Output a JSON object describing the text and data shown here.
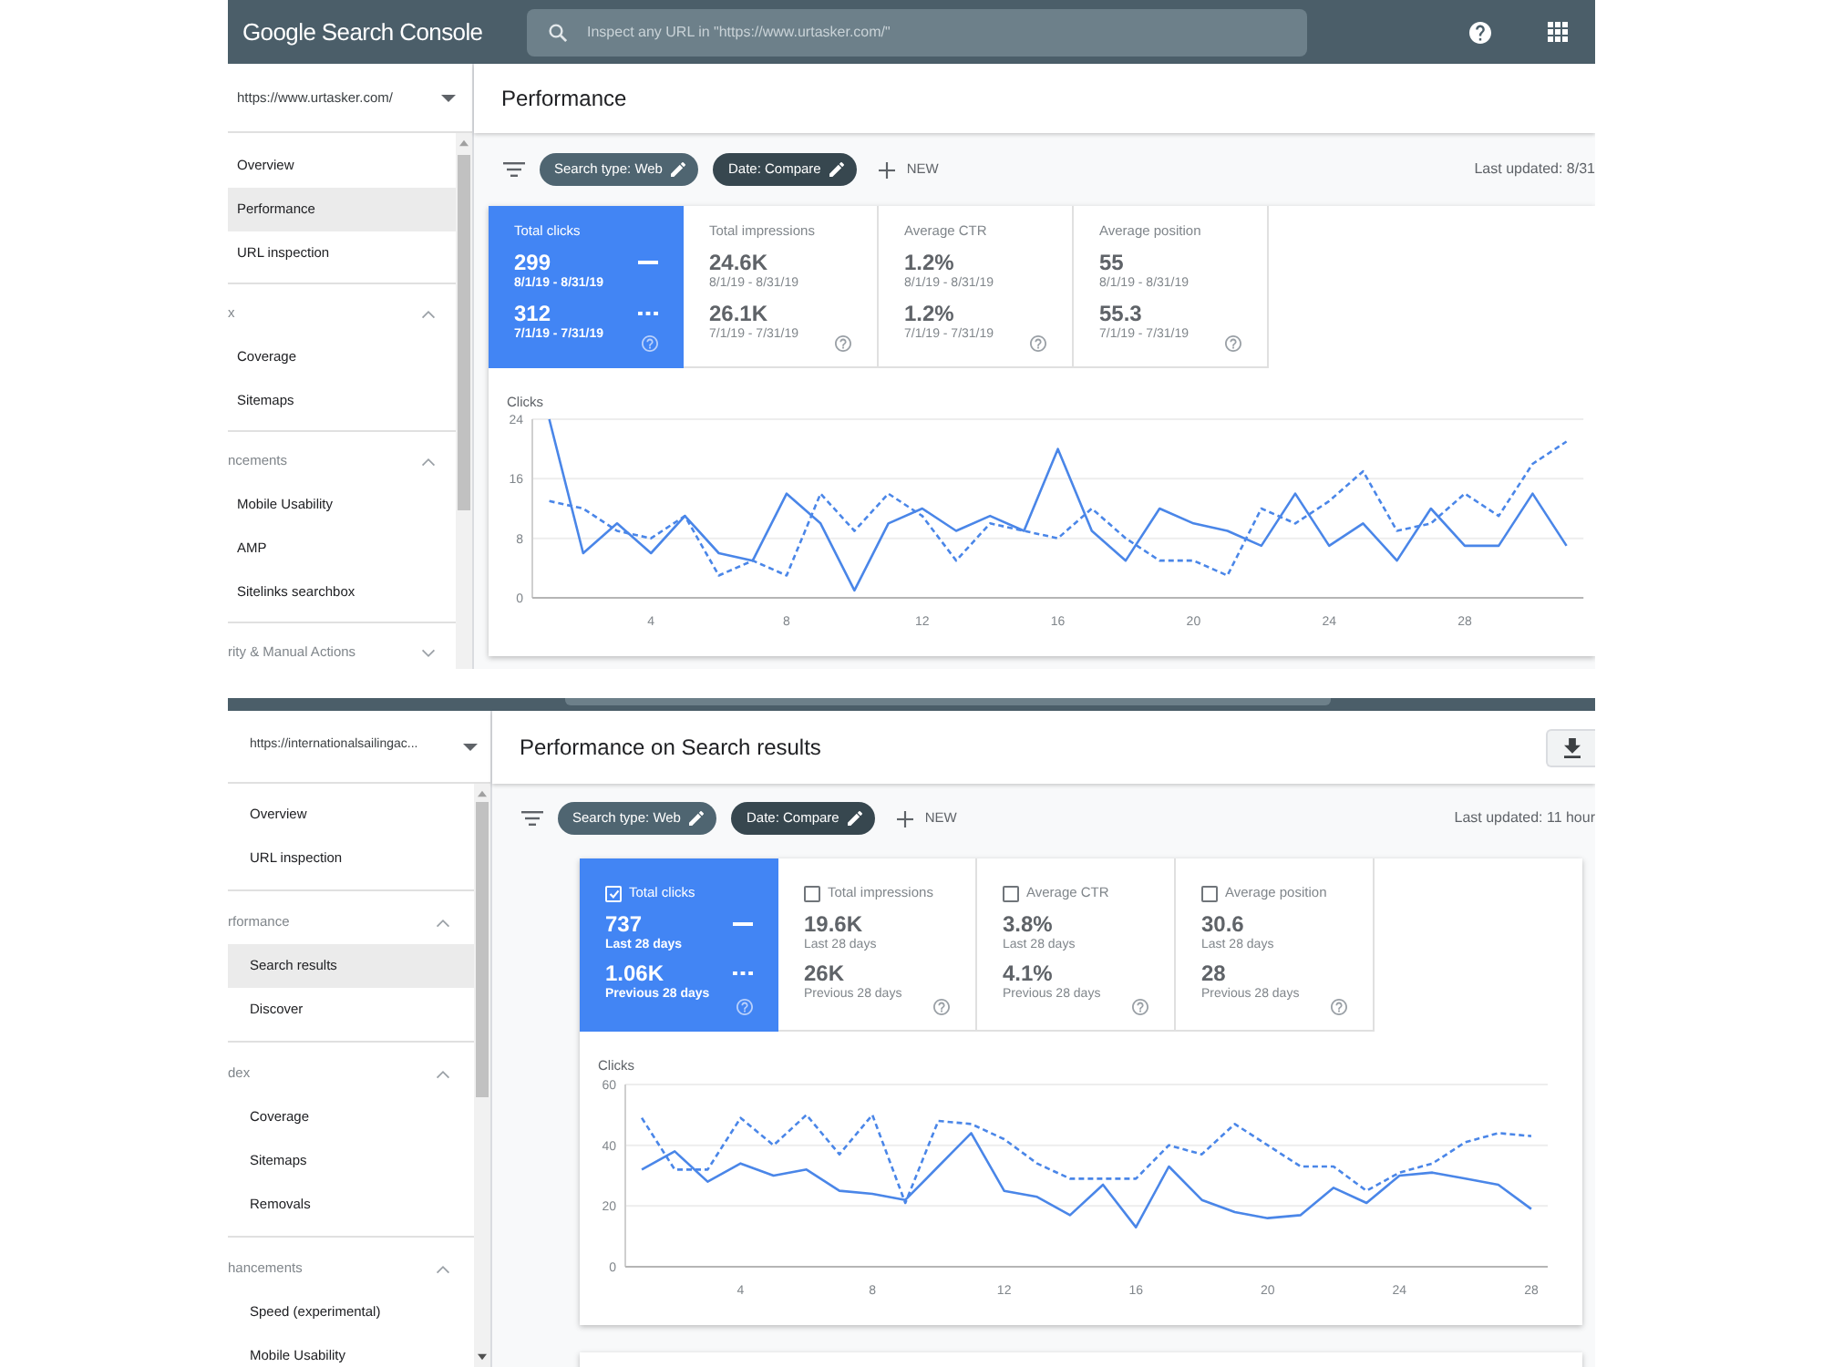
{
  "screens": [
    {
      "header": {
        "kind": "full",
        "logo": "Google Search Console",
        "search": {
          "placeholder": "Inspect any URL in \"https://www.urtasker.com/\""
        }
      },
      "sidebar": {
        "property": "https://www.urtasker.com/",
        "nav": [
          {
            "kind": "link",
            "label": "Overview",
            "selected": false
          },
          {
            "kind": "link",
            "label": "Performance",
            "selected": true
          },
          {
            "kind": "link",
            "label": "URL inspection",
            "selected": false
          },
          {
            "kind": "section",
            "label": "x",
            "expanded": true,
            "children": [
              {
                "label": "Coverage",
                "selected": false
              },
              {
                "label": "Sitemaps",
                "selected": false
              }
            ]
          },
          {
            "kind": "section",
            "label": "ncements",
            "expanded": true,
            "children": [
              {
                "label": "Mobile Usability",
                "selected": false
              },
              {
                "label": "AMP",
                "selected": false
              },
              {
                "label": "Sitelinks searchbox",
                "selected": false
              }
            ]
          },
          {
            "kind": "section",
            "label": "rity & Manual Actions",
            "expanded": false
          }
        ]
      },
      "page_title": "Performance",
      "filters": {
        "chips": [
          {
            "label": "Search type: Web",
            "color": "#4f6571"
          },
          {
            "label": "Date: Compare",
            "color": "#37474f"
          }
        ],
        "new_label": "NEW",
        "last_updated": "Last updated: 8/31"
      },
      "metrics": [
        {
          "label": "Total clicks",
          "selected": true,
          "rows": [
            {
              "value": "299",
              "period": "8/1/19 - 8/31/19"
            },
            {
              "value": "312",
              "period": "7/1/19 - 7/31/19"
            }
          ]
        },
        {
          "label": "Total impressions",
          "selected": false,
          "rows": [
            {
              "value": "24.6K",
              "period": "8/1/19 - 8/31/19"
            },
            {
              "value": "26.1K",
              "period": "7/1/19 - 7/31/19"
            }
          ]
        },
        {
          "label": "Average CTR",
          "selected": false,
          "rows": [
            {
              "value": "1.2%",
              "period": "8/1/19 - 8/31/19"
            },
            {
              "value": "1.2%",
              "period": "7/1/19 - 7/31/19"
            }
          ]
        },
        {
          "label": "Average position",
          "selected": false,
          "rows": [
            {
              "value": "55",
              "period": "8/1/19 - 8/31/19"
            },
            {
              "value": "55.3",
              "period": "7/1/19 - 7/31/19"
            }
          ]
        }
      ],
      "chart_data": {
        "type": "line",
        "ylabel": "Clicks",
        "x": [
          1,
          2,
          3,
          4,
          5,
          6,
          7,
          8,
          9,
          10,
          11,
          12,
          13,
          14,
          15,
          16,
          17,
          18,
          19,
          20,
          21,
          22,
          23,
          24,
          25,
          26,
          27,
          28,
          29,
          30,
          31
        ],
        "xlim": [
          0.5,
          31.5
        ],
        "ylim": [
          0,
          24
        ],
        "xticks": [
          4,
          8,
          12,
          16,
          20,
          24,
          28
        ],
        "yticks": [
          0,
          8,
          16,
          24
        ],
        "series": [
          {
            "color": "#4a86e8",
            "line_style": "solid",
            "values": [
              24,
              6,
              10,
              6,
              11,
              6,
              5,
              14,
              10,
              1,
              10,
              12,
              9,
              11,
              9,
              20,
              9,
              5,
              12,
              10,
              9,
              7,
              14,
              7,
              10,
              5,
              12,
              7,
              7,
              14,
              7
            ]
          },
          {
            "color": "#4a86e8",
            "line_style": "dashed",
            "values": [
              13,
              12,
              9,
              8,
              11,
              3,
              5,
              3,
              14,
              9,
              14,
              11,
              5,
              10,
              9,
              8,
              12,
              8,
              5,
              5,
              3,
              12,
              10,
              13,
              17,
              9,
              10,
              14,
              11,
              18,
              21
            ]
          }
        ]
      }
    },
    {
      "header": {
        "kind": "cut"
      },
      "sidebar": {
        "property": "https://internationalsailingac...",
        "nav": [
          {
            "kind": "link",
            "label": "Overview",
            "selected": false
          },
          {
            "kind": "link",
            "label": "URL inspection",
            "selected": false
          },
          {
            "kind": "section",
            "label": "rformance",
            "expanded": true,
            "children": [
              {
                "label": "Search results",
                "selected": true
              },
              {
                "label": "Discover",
                "selected": false
              }
            ]
          },
          {
            "kind": "section",
            "label": "dex",
            "expanded": true,
            "children": [
              {
                "label": "Coverage",
                "selected": false
              },
              {
                "label": "Sitemaps",
                "selected": false
              },
              {
                "label": "Removals",
                "selected": false
              }
            ]
          },
          {
            "kind": "section",
            "label": "hancements",
            "expanded": true,
            "children": [
              {
                "label": "Speed (experimental)",
                "selected": false
              },
              {
                "label": "Mobile Usability",
                "selected": false
              }
            ]
          }
        ]
      },
      "page_title": "Performance on Search results",
      "download_button": true,
      "filters": {
        "chips": [
          {
            "label": "Search type: Web",
            "color": "#4f6571"
          },
          {
            "label": "Date: Compare",
            "color": "#37474f"
          }
        ],
        "new_label": "NEW",
        "last_updated": "Last updated: 11 hour"
      },
      "metrics": [
        {
          "label": "Total clicks",
          "selected": true,
          "checked": true,
          "rows": [
            {
              "value": "737",
              "period": "Last 28 days"
            },
            {
              "value": "1.06K",
              "period": "Previous 28 days"
            }
          ]
        },
        {
          "label": "Total impressions",
          "selected": false,
          "checked": false,
          "rows": [
            {
              "value": "19.6K",
              "period": "Last 28 days"
            },
            {
              "value": "26K",
              "period": "Previous 28 days"
            }
          ]
        },
        {
          "label": "Average CTR",
          "selected": false,
          "checked": false,
          "rows": [
            {
              "value": "3.8%",
              "period": "Last 28 days"
            },
            {
              "value": "4.1%",
              "period": "Previous 28 days"
            }
          ]
        },
        {
          "label": "Average position",
          "selected": false,
          "checked": false,
          "rows": [
            {
              "value": "30.6",
              "period": "Last 28 days"
            },
            {
              "value": "28",
              "period": "Previous 28 days"
            }
          ]
        }
      ],
      "chart_data": {
        "type": "line",
        "ylabel": "Clicks",
        "x": [
          1,
          2,
          3,
          4,
          5,
          6,
          7,
          8,
          9,
          10,
          11,
          12,
          13,
          14,
          15,
          16,
          17,
          18,
          19,
          20,
          21,
          22,
          23,
          24,
          25,
          26,
          27,
          28
        ],
        "xlim": [
          0.5,
          28.5
        ],
        "ylim": [
          0,
          60
        ],
        "xticks": [
          4,
          8,
          12,
          16,
          20,
          24,
          28
        ],
        "yticks": [
          0,
          20,
          40,
          60
        ],
        "series": [
          {
            "color": "#4a86e8",
            "line_style": "solid",
            "values": [
              32,
              38,
              28,
              34,
              30,
              32,
              25,
              24,
              22,
              33,
              44,
              25,
              23,
              17,
              27,
              13,
              33,
              22,
              18,
              16,
              17,
              26,
              21,
              30,
              31,
              29,
              27,
              19
            ]
          },
          {
            "color": "#4a86e8",
            "line_style": "dashed",
            "values": [
              49,
              32,
              32,
              49,
              40,
              50,
              37,
              50,
              21,
              48,
              47,
              42,
              34,
              29,
              29,
              29,
              40,
              37,
              47,
              40,
              33,
              33,
              25,
              31,
              34,
              41,
              44,
              43
            ]
          }
        ]
      }
    }
  ]
}
